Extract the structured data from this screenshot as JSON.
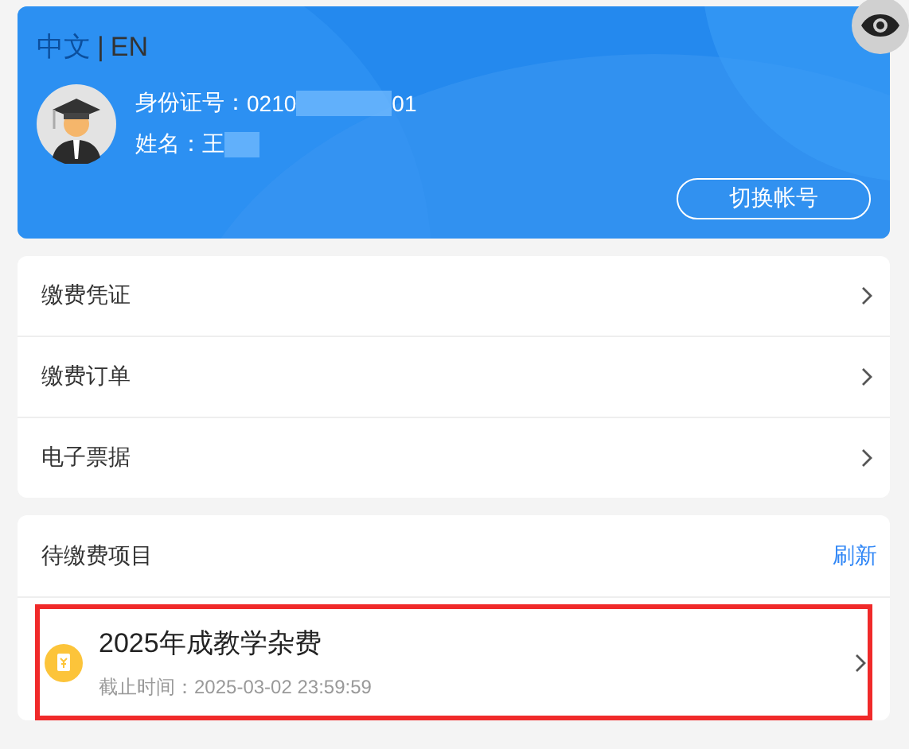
{
  "languages": [
    {
      "label": "中文",
      "selected": true
    },
    {
      "label": "EN",
      "selected": false
    }
  ],
  "language_separator": "|",
  "profile": {
    "id_label": "身份证号：",
    "id_value_start": "0210",
    "id_value_end": "01",
    "name_label": "姓名：",
    "name_value": "王"
  },
  "switch_account_button": "切换帐号",
  "menu": [
    {
      "label": "缴费凭证"
    },
    {
      "label": "缴费订单"
    },
    {
      "label": "电子票据"
    }
  ],
  "pending": {
    "title": "待缴费项目",
    "refresh": "刷新",
    "items": [
      {
        "name": "2025年成教学杂费",
        "deadline": "截止时间：2025-03-02 23:59:59",
        "highlighted": true
      }
    ]
  }
}
